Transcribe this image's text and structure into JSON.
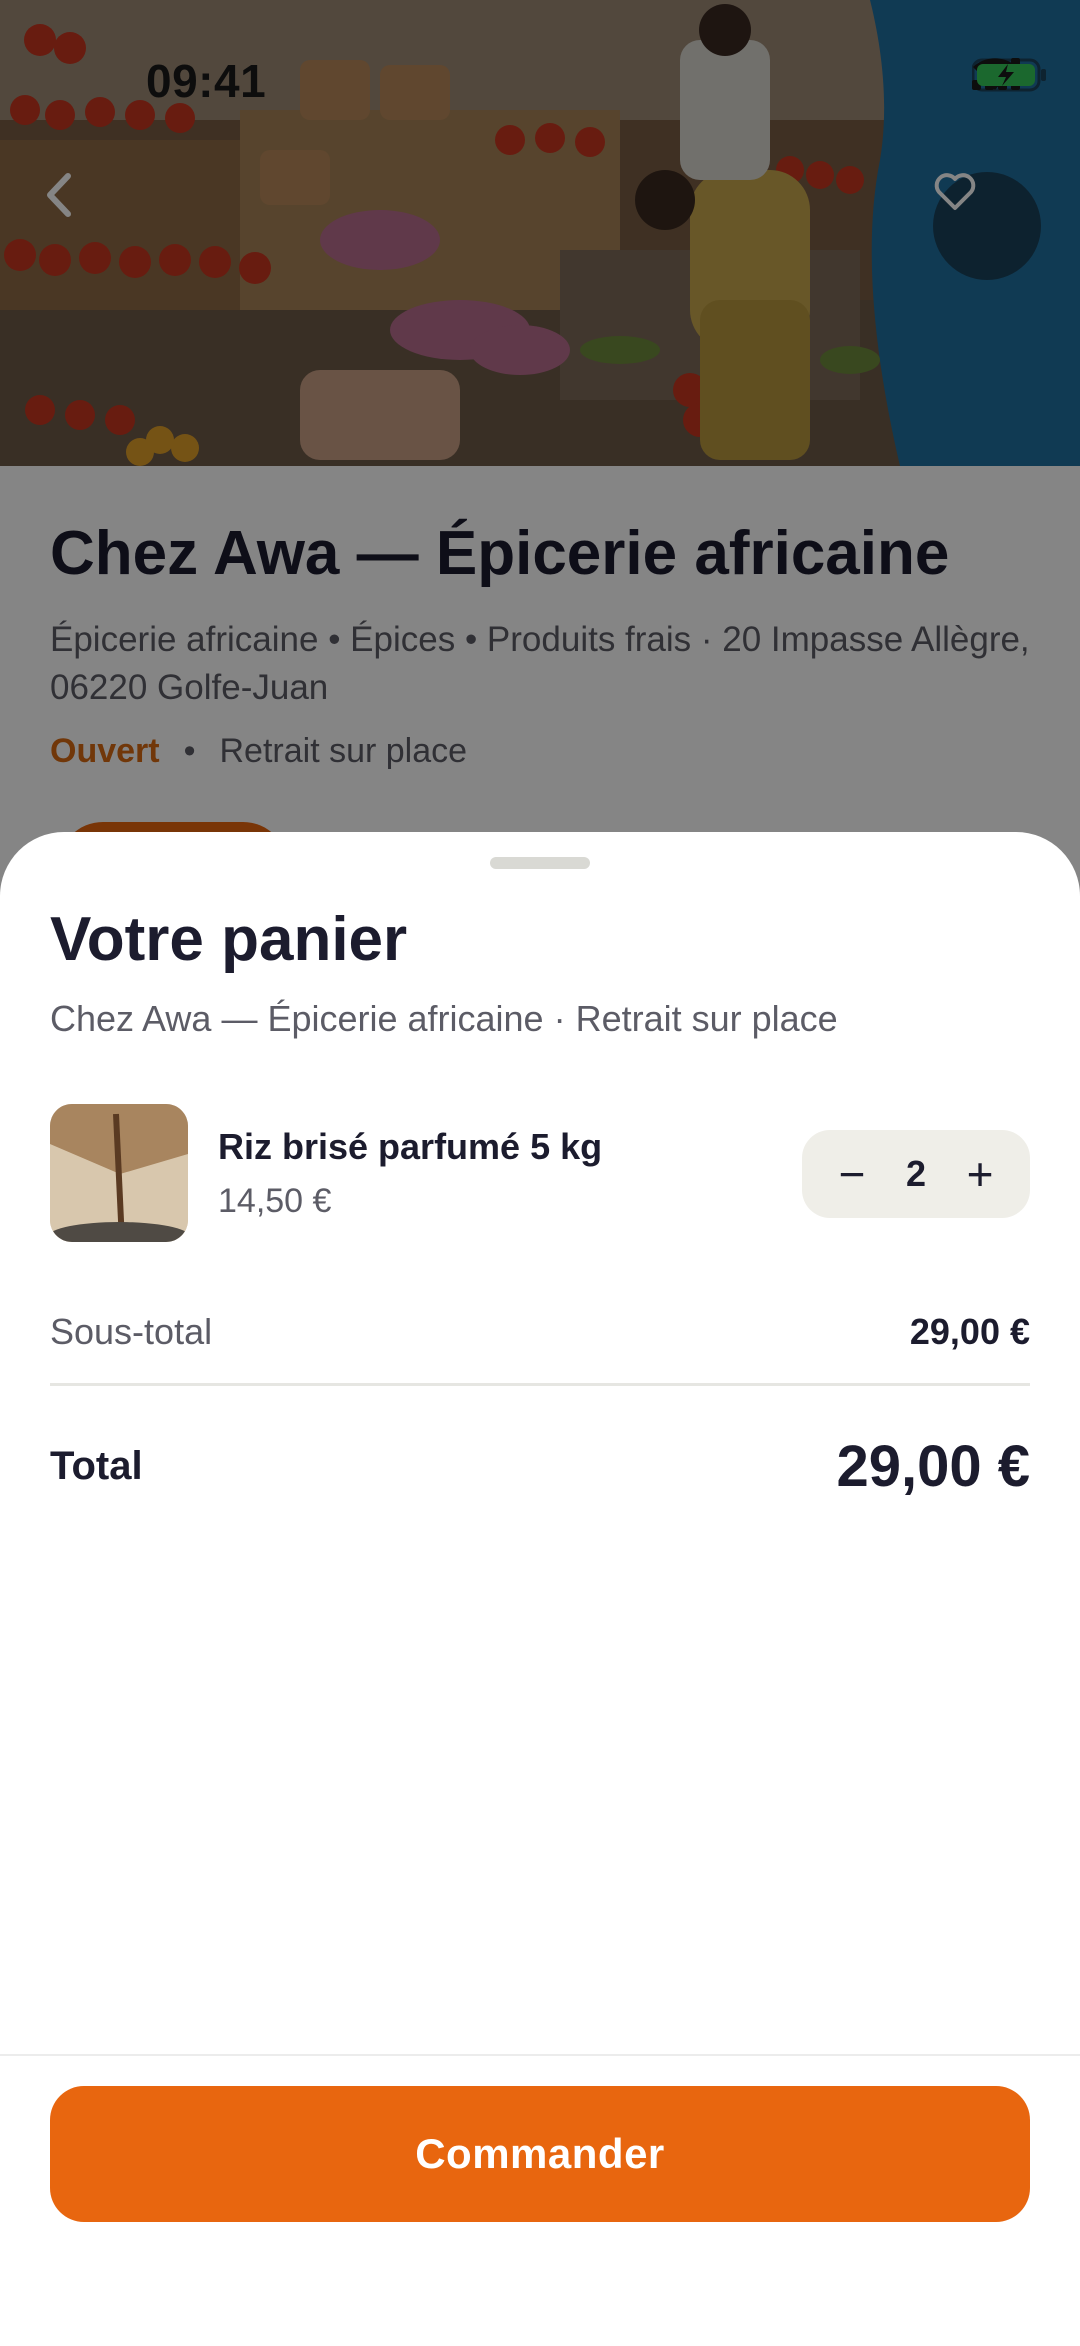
{
  "status_bar": {
    "time": "09:41"
  },
  "store": {
    "name": "Chez Awa — Épicerie africaine",
    "meta": "Épicerie africaine • Épices • Produits frais · 20 Impasse Allègre, 06220 Golfe-Juan",
    "status": "Ouvert",
    "separator": "•",
    "pickup": "Retrait sur place"
  },
  "cart": {
    "title": "Votre panier",
    "subtitle": "Chez Awa — Épicerie africaine · Retrait sur place",
    "items": [
      {
        "name": "Riz brisé parfumé 5 kg",
        "price": "14,50 €",
        "quantity": "2",
        "minus": "−",
        "plus": "+"
      }
    ],
    "subtotal_label": "Sous-total",
    "subtotal_value": "29,00 €",
    "total_label": "Total",
    "total_value": "29,00 €",
    "order_button": "Commander"
  },
  "colors": {
    "accent": "#e8660f",
    "open_status": "#d86a12",
    "text_primary": "#1c1c2e",
    "text_secondary": "#5c5c66"
  },
  "icons": {
    "back": "chevron-left-icon",
    "favorite": "heart-icon",
    "signal": "signal-icon",
    "wifi": "wifi-icon",
    "battery": "battery-charging-icon"
  }
}
